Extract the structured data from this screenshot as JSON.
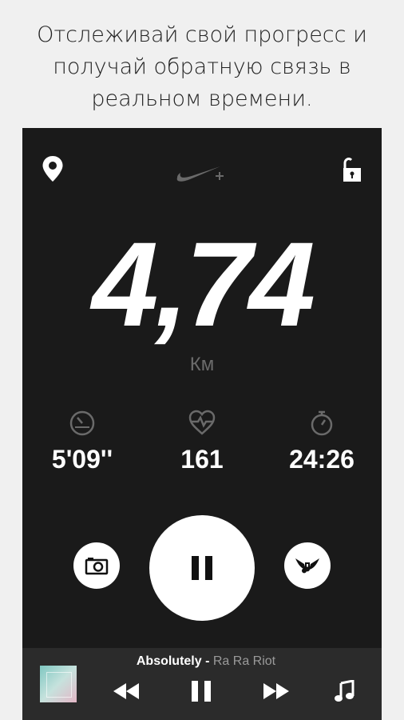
{
  "caption": {
    "line1": "Отслеживай свой прогресс и",
    "line2": "получай обратную связь в",
    "line3": "реальном времени."
  },
  "topbar": {
    "left_icon": "location-pin-icon",
    "center_logo": "nike-plus-logo",
    "right_icon": "unlock-icon"
  },
  "run": {
    "distance": "4,74",
    "unit": "Км",
    "pace": "5'09''",
    "heart_rate": "161",
    "duration": "24:26"
  },
  "controls": {
    "left": "camera-icon",
    "center": "pause-icon",
    "right": "cheer-icon"
  },
  "music": {
    "title": "Absolutely",
    "separator": " - ",
    "artist": "Ra Ra Riot"
  },
  "colors": {
    "background": "#f0f0f0",
    "panel": "#1a1a1a",
    "music_bar": "#2b2b2b",
    "unit_text": "#6b6b6b"
  }
}
